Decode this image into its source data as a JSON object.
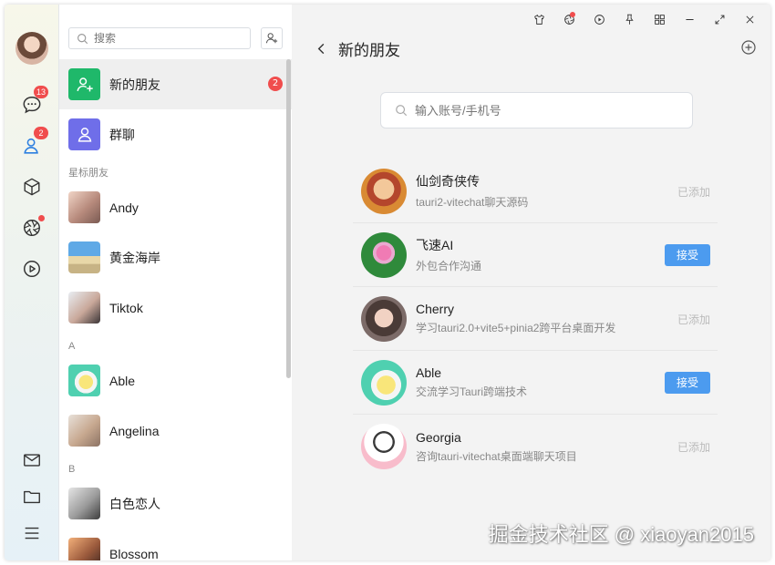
{
  "sidebar": {
    "chat_badge": "13",
    "contacts_badge": "2",
    "icons": [
      "chat-icon",
      "contacts-icon",
      "cube-icon",
      "aperture-icon",
      "play-icon",
      "mail-icon",
      "folder-icon",
      "menu-icon"
    ]
  },
  "contacts_panel": {
    "search_placeholder": "搜索",
    "new_friends_label": "新的朋友",
    "new_friends_count": "2",
    "group_chat_label": "群聊",
    "starred_section": "星标朋友",
    "starred": [
      {
        "name": "Andy"
      },
      {
        "name": "黄金海岸"
      },
      {
        "name": "Tiktok"
      }
    ],
    "section_a": "A",
    "a_contacts": [
      {
        "name": "Able"
      },
      {
        "name": "Angelina"
      }
    ],
    "section_b": "B",
    "b_contacts": [
      {
        "name": "白色恋人"
      },
      {
        "name": "Blossom"
      }
    ]
  },
  "main": {
    "title": "新的朋友",
    "search_placeholder": "输入账号/手机号",
    "requests": [
      {
        "name": "仙剑奇侠传",
        "message": "tauri2-vitechat聊天源码",
        "status": "已添加"
      },
      {
        "name": "飞速AI",
        "message": "外包合作沟通",
        "action": "接受"
      },
      {
        "name": "Cherry",
        "message": "学习tauri2.0+vite5+pinia2跨平台桌面开发",
        "status": "已添加"
      },
      {
        "name": "Able",
        "message": "交流学习Tauri跨端技术",
        "action": "接受"
      },
      {
        "name": "Georgia",
        "message": "咨询tauri-vitechat桌面端聊天项目",
        "status": "已添加"
      }
    ]
  },
  "watermark": "掘金技术社区 @ xiaoyan2015",
  "colors": {
    "accent": "#4c9bef",
    "badge": "#f04d4d",
    "new_friends_icon": "#1fb86a",
    "group_icon": "#6f6ee9"
  }
}
